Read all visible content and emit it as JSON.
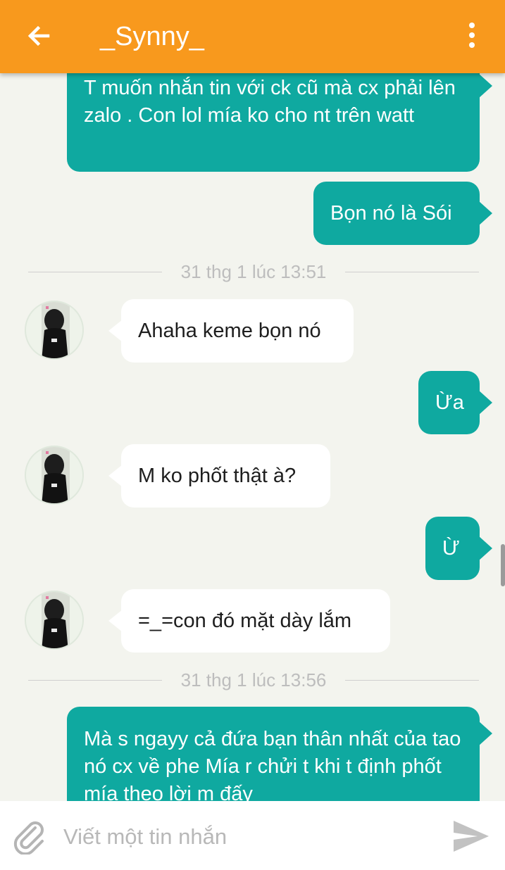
{
  "header": {
    "title": "_Synny_",
    "back_icon": "arrow-back-icon",
    "more_icon": "more-vert-icon",
    "accent": "#f8991d"
  },
  "messages": [
    {
      "direction": "outgoing",
      "text": "T muốn nhắn tin với ck cũ mà cx phải lên zalo . Con lol mía ko cho nt trên watt"
    },
    {
      "direction": "outgoing",
      "text": "Bọn nó là Sói"
    },
    {
      "type": "timestamp",
      "text": "31 thg 1 lúc 13:51"
    },
    {
      "direction": "incoming",
      "text": "Ahaha keme bọn nó"
    },
    {
      "direction": "outgoing",
      "text": "Ừa"
    },
    {
      "direction": "incoming",
      "text": "M ko phốt thật à?"
    },
    {
      "direction": "outgoing",
      "text": "Ừ"
    },
    {
      "direction": "incoming",
      "text": "=_=con đó mặt dày lắm"
    },
    {
      "type": "timestamp",
      "text": "31 thg 1 lúc 13:56"
    },
    {
      "direction": "outgoing",
      "text": "Mà s ngayy cả đứa bạn thân nhất của tao nó cx về phe Mía r chửi t khi t định phốt mía theo lời m đấy"
    }
  ],
  "colors": {
    "outgoing_bubble": "#0fa9a0",
    "incoming_bubble": "#ffffff",
    "chat_background": "#f3f4ee"
  },
  "composer": {
    "placeholder": "Viết một tin nhắn",
    "value": "",
    "attach_icon": "paperclip-icon",
    "send_icon": "send-icon"
  }
}
